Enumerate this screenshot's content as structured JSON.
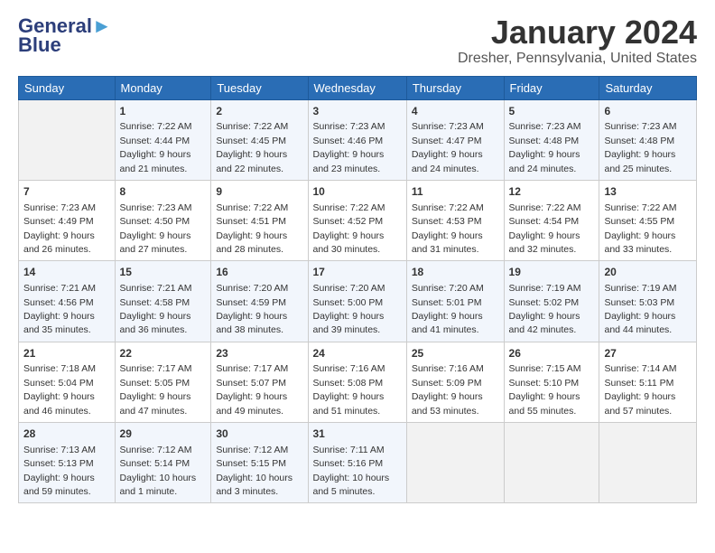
{
  "header": {
    "logo_general": "General",
    "logo_blue": "Blue",
    "title": "January 2024",
    "subtitle": "Dresher, Pennsylvania, United States"
  },
  "days_of_week": [
    "Sunday",
    "Monday",
    "Tuesday",
    "Wednesday",
    "Thursday",
    "Friday",
    "Saturday"
  ],
  "weeks": [
    [
      {
        "num": "",
        "sunrise": "",
        "sunset": "",
        "daylight": ""
      },
      {
        "num": "1",
        "sunrise": "Sunrise: 7:22 AM",
        "sunset": "Sunset: 4:44 PM",
        "daylight": "Daylight: 9 hours and 21 minutes."
      },
      {
        "num": "2",
        "sunrise": "Sunrise: 7:22 AM",
        "sunset": "Sunset: 4:45 PM",
        "daylight": "Daylight: 9 hours and 22 minutes."
      },
      {
        "num": "3",
        "sunrise": "Sunrise: 7:23 AM",
        "sunset": "Sunset: 4:46 PM",
        "daylight": "Daylight: 9 hours and 23 minutes."
      },
      {
        "num": "4",
        "sunrise": "Sunrise: 7:23 AM",
        "sunset": "Sunset: 4:47 PM",
        "daylight": "Daylight: 9 hours and 24 minutes."
      },
      {
        "num": "5",
        "sunrise": "Sunrise: 7:23 AM",
        "sunset": "Sunset: 4:48 PM",
        "daylight": "Daylight: 9 hours and 24 minutes."
      },
      {
        "num": "6",
        "sunrise": "Sunrise: 7:23 AM",
        "sunset": "Sunset: 4:48 PM",
        "daylight": "Daylight: 9 hours and 25 minutes."
      }
    ],
    [
      {
        "num": "7",
        "sunrise": "Sunrise: 7:23 AM",
        "sunset": "Sunset: 4:49 PM",
        "daylight": "Daylight: 9 hours and 26 minutes."
      },
      {
        "num": "8",
        "sunrise": "Sunrise: 7:23 AM",
        "sunset": "Sunset: 4:50 PM",
        "daylight": "Daylight: 9 hours and 27 minutes."
      },
      {
        "num": "9",
        "sunrise": "Sunrise: 7:22 AM",
        "sunset": "Sunset: 4:51 PM",
        "daylight": "Daylight: 9 hours and 28 minutes."
      },
      {
        "num": "10",
        "sunrise": "Sunrise: 7:22 AM",
        "sunset": "Sunset: 4:52 PM",
        "daylight": "Daylight: 9 hours and 30 minutes."
      },
      {
        "num": "11",
        "sunrise": "Sunrise: 7:22 AM",
        "sunset": "Sunset: 4:53 PM",
        "daylight": "Daylight: 9 hours and 31 minutes."
      },
      {
        "num": "12",
        "sunrise": "Sunrise: 7:22 AM",
        "sunset": "Sunset: 4:54 PM",
        "daylight": "Daylight: 9 hours and 32 minutes."
      },
      {
        "num": "13",
        "sunrise": "Sunrise: 7:22 AM",
        "sunset": "Sunset: 4:55 PM",
        "daylight": "Daylight: 9 hours and 33 minutes."
      }
    ],
    [
      {
        "num": "14",
        "sunrise": "Sunrise: 7:21 AM",
        "sunset": "Sunset: 4:56 PM",
        "daylight": "Daylight: 9 hours and 35 minutes."
      },
      {
        "num": "15",
        "sunrise": "Sunrise: 7:21 AM",
        "sunset": "Sunset: 4:58 PM",
        "daylight": "Daylight: 9 hours and 36 minutes."
      },
      {
        "num": "16",
        "sunrise": "Sunrise: 7:20 AM",
        "sunset": "Sunset: 4:59 PM",
        "daylight": "Daylight: 9 hours and 38 minutes."
      },
      {
        "num": "17",
        "sunrise": "Sunrise: 7:20 AM",
        "sunset": "Sunset: 5:00 PM",
        "daylight": "Daylight: 9 hours and 39 minutes."
      },
      {
        "num": "18",
        "sunrise": "Sunrise: 7:20 AM",
        "sunset": "Sunset: 5:01 PM",
        "daylight": "Daylight: 9 hours and 41 minutes."
      },
      {
        "num": "19",
        "sunrise": "Sunrise: 7:19 AM",
        "sunset": "Sunset: 5:02 PM",
        "daylight": "Daylight: 9 hours and 42 minutes."
      },
      {
        "num": "20",
        "sunrise": "Sunrise: 7:19 AM",
        "sunset": "Sunset: 5:03 PM",
        "daylight": "Daylight: 9 hours and 44 minutes."
      }
    ],
    [
      {
        "num": "21",
        "sunrise": "Sunrise: 7:18 AM",
        "sunset": "Sunset: 5:04 PM",
        "daylight": "Daylight: 9 hours and 46 minutes."
      },
      {
        "num": "22",
        "sunrise": "Sunrise: 7:17 AM",
        "sunset": "Sunset: 5:05 PM",
        "daylight": "Daylight: 9 hours and 47 minutes."
      },
      {
        "num": "23",
        "sunrise": "Sunrise: 7:17 AM",
        "sunset": "Sunset: 5:07 PM",
        "daylight": "Daylight: 9 hours and 49 minutes."
      },
      {
        "num": "24",
        "sunrise": "Sunrise: 7:16 AM",
        "sunset": "Sunset: 5:08 PM",
        "daylight": "Daylight: 9 hours and 51 minutes."
      },
      {
        "num": "25",
        "sunrise": "Sunrise: 7:16 AM",
        "sunset": "Sunset: 5:09 PM",
        "daylight": "Daylight: 9 hours and 53 minutes."
      },
      {
        "num": "26",
        "sunrise": "Sunrise: 7:15 AM",
        "sunset": "Sunset: 5:10 PM",
        "daylight": "Daylight: 9 hours and 55 minutes."
      },
      {
        "num": "27",
        "sunrise": "Sunrise: 7:14 AM",
        "sunset": "Sunset: 5:11 PM",
        "daylight": "Daylight: 9 hours and 57 minutes."
      }
    ],
    [
      {
        "num": "28",
        "sunrise": "Sunrise: 7:13 AM",
        "sunset": "Sunset: 5:13 PM",
        "daylight": "Daylight: 9 hours and 59 minutes."
      },
      {
        "num": "29",
        "sunrise": "Sunrise: 7:12 AM",
        "sunset": "Sunset: 5:14 PM",
        "daylight": "Daylight: 10 hours and 1 minute."
      },
      {
        "num": "30",
        "sunrise": "Sunrise: 7:12 AM",
        "sunset": "Sunset: 5:15 PM",
        "daylight": "Daylight: 10 hours and 3 minutes."
      },
      {
        "num": "31",
        "sunrise": "Sunrise: 7:11 AM",
        "sunset": "Sunset: 5:16 PM",
        "daylight": "Daylight: 10 hours and 5 minutes."
      },
      {
        "num": "",
        "sunrise": "",
        "sunset": "",
        "daylight": ""
      },
      {
        "num": "",
        "sunrise": "",
        "sunset": "",
        "daylight": ""
      },
      {
        "num": "",
        "sunrise": "",
        "sunset": "",
        "daylight": ""
      }
    ]
  ]
}
